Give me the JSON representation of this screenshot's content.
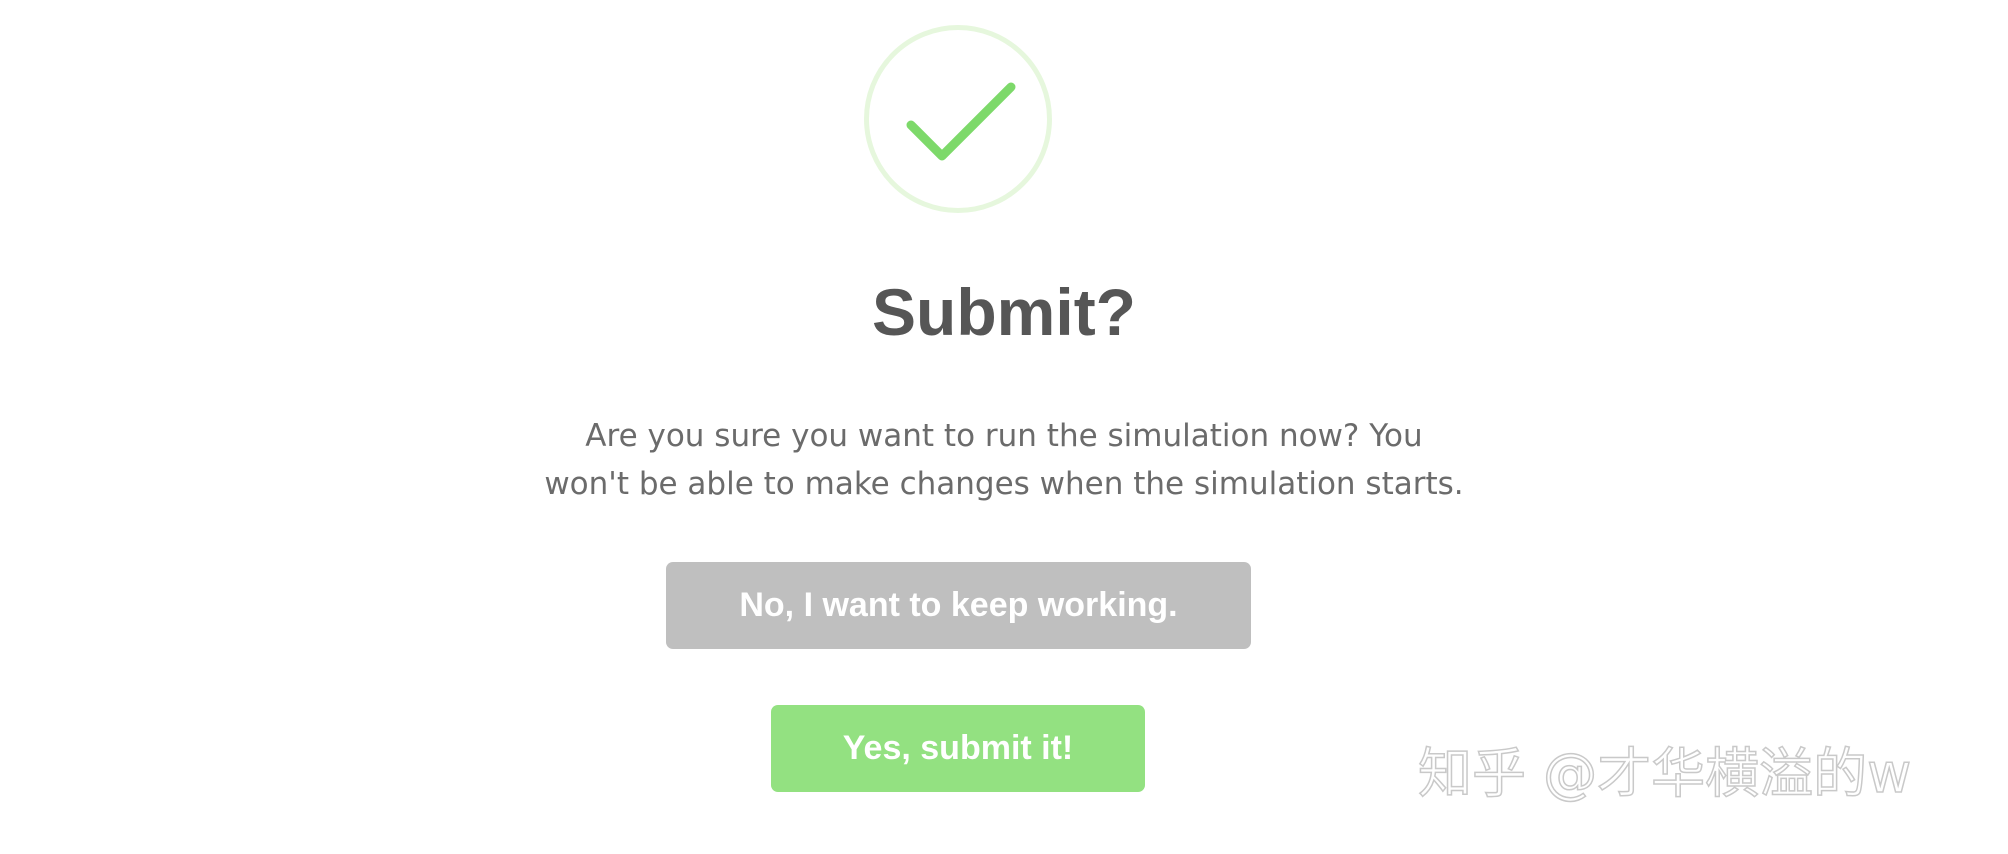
{
  "dialog": {
    "icon": "check-icon",
    "title": "Submit?",
    "message_lines": [
      "Are you sure you want to run the simulation now? You",
      "won't be able to make changes when the simulation starts."
    ],
    "cancel_label": "No, I want to keep working.",
    "confirm_label": "Yes, submit it!"
  },
  "watermark": "知乎 @才华横溢的w",
  "colors": {
    "success": "#7dd96a",
    "success_ring": "#e6f7dd",
    "title": "#565656",
    "message": "#6b6b6b",
    "cancel_bg": "#bfbfbf",
    "confirm_bg": "#93e181",
    "button_text": "#ffffff"
  }
}
